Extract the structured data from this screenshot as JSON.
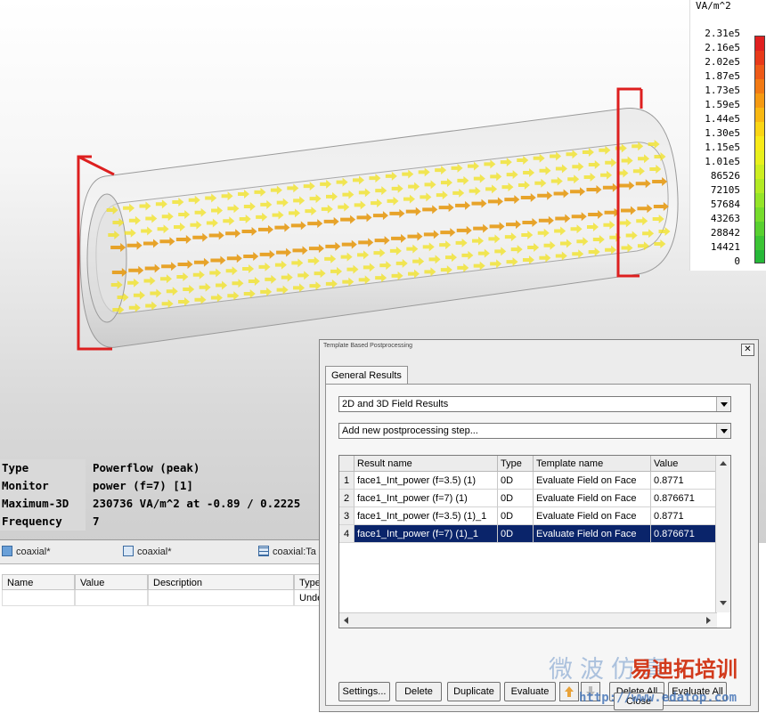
{
  "legend": {
    "unit": "VA/m^2",
    "labels": [
      "2.31e5",
      "2.16e5",
      "2.02e5",
      "1.87e5",
      "1.73e5",
      "1.59e5",
      "1.44e5",
      "1.30e5",
      "1.15e5",
      "1.01e5",
      "86526",
      "72105",
      "57684",
      "43263",
      "28842",
      "14421",
      "0"
    ],
    "colors": [
      "#e02020",
      "#e83a1a",
      "#ee5a18",
      "#f27a14",
      "#f59a12",
      "#f8b812",
      "#fad514",
      "#f8ea18",
      "#e8f01c",
      "#cdee20",
      "#b2ea24",
      "#94e428",
      "#76dc2c",
      "#58d030",
      "#3cc434",
      "#26b838"
    ]
  },
  "info": [
    {
      "key": "Type",
      "value": "Powerflow (peak)"
    },
    {
      "key": "Monitor",
      "value": "power (f=7) [1]"
    },
    {
      "key": "Maximum-3D",
      "value": "230736 VA/m^2 at -0.89 / 0.2225"
    },
    {
      "key": "Frequency",
      "value": "7"
    }
  ],
  "bottom_tabs": [
    "coaxial*",
    "coaxial*",
    "coaxial:Ta"
  ],
  "param_table": {
    "headers": [
      "Name",
      "Value",
      "Description",
      "Type"
    ],
    "row": [
      "",
      "",
      "",
      "Unde"
    ]
  },
  "dialog": {
    "title": "Template Based Postprocessing",
    "tab": "General Results",
    "category": "2D and 3D Field Results",
    "step_placeholder": "Add new postprocessing step...",
    "columns": [
      "Result name",
      "Type",
      "Template name",
      "Value"
    ],
    "rows": [
      {
        "num": "1",
        "name": "face1_Int_power (f=3.5) (1)",
        "type": "0D",
        "template": "Evaluate Field on Face",
        "value": "0.8771"
      },
      {
        "num": "2",
        "name": "face1_Int_power (f=7) (1)",
        "type": "0D",
        "template": "Evaluate Field on Face",
        "value": "0.876671"
      },
      {
        "num": "3",
        "name": "face1_Int_power (f=3.5) (1)_1",
        "type": "0D",
        "template": "Evaluate Field on Face",
        "value": "0.8771"
      },
      {
        "num": "4",
        "name": "face1_Int_power (f=7) (1)_1",
        "type": "0D",
        "template": "Evaluate Field on Face",
        "value": "0.876671"
      }
    ],
    "selected_row": 4,
    "buttons": {
      "settings": "Settings...",
      "delete": "Delete",
      "duplicate": "Duplicate",
      "evaluate": "Evaluate",
      "delete_all": "Delete All",
      "evaluate_all": "Evaluate All",
      "close": "Close"
    }
  },
  "watermark": {
    "text_cn": "微波仿真",
    "brand": "易迪拓培训",
    "url": "http://www.edatop.com"
  },
  "colors": {
    "selection": "#0a246a",
    "frame_red": "#dd1f1f",
    "arrow_yellow": "#f2e21e",
    "arrow_orange": "#e69a14"
  }
}
